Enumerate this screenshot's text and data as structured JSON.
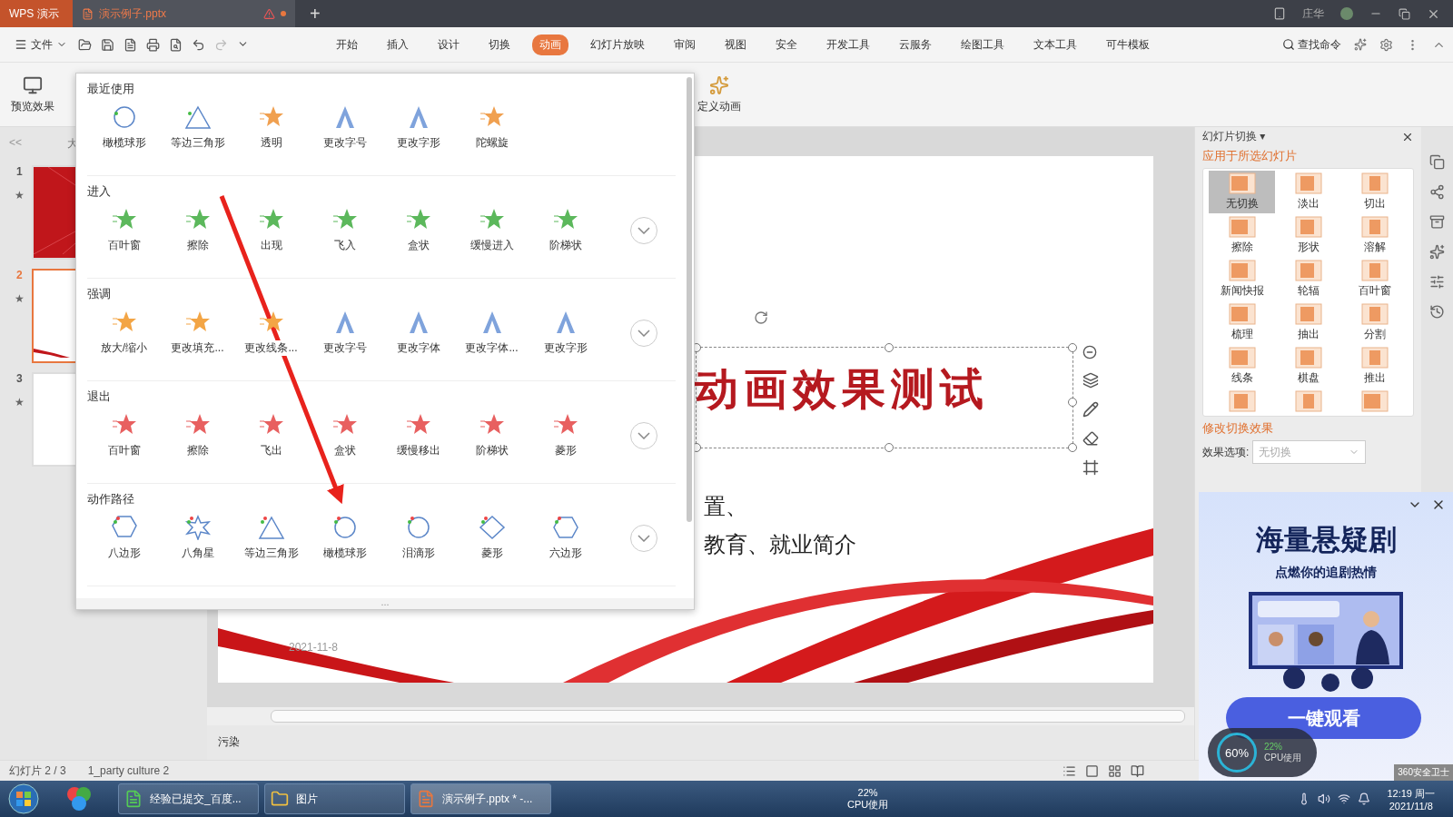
{
  "title_bar": {
    "tabs": [
      {
        "label": "WPS 演示",
        "kind": "app",
        "selected": false
      },
      {
        "label": "演示例子.pptx",
        "kind": "doc",
        "selected": true
      }
    ],
    "new_tab": "+",
    "user": "庄华"
  },
  "menu_bar": {
    "file": "文件",
    "tabs": [
      {
        "label": "开始",
        "selected": false
      },
      {
        "label": "插入",
        "selected": false
      },
      {
        "label": "设计",
        "selected": false
      },
      {
        "label": "切换",
        "selected": false
      },
      {
        "label": "动画",
        "selected": true
      },
      {
        "label": "幻灯片放映",
        "selected": false
      },
      {
        "label": "审阅",
        "selected": false
      },
      {
        "label": "视图",
        "selected": false
      },
      {
        "label": "安全",
        "selected": false
      },
      {
        "label": "开发工具",
        "selected": false
      },
      {
        "label": "云服务",
        "selected": false
      },
      {
        "label": "绘图工具",
        "selected": false
      },
      {
        "label": "文本工具",
        "selected": false
      },
      {
        "label": "可牛模板",
        "selected": false
      }
    ],
    "search": "查找命令"
  },
  "ribbon": {
    "preview": "预览效果",
    "custom_animation": "定义动画"
  },
  "animation_gallery": {
    "sections": [
      {
        "kind": "recent",
        "title": "最近使用",
        "expandable": false,
        "items": [
          "橄榄球形",
          "等边三角形",
          "透明",
          "更改字号",
          "更改字形",
          "陀螺旋"
        ]
      },
      {
        "kind": "enter",
        "title": "进入",
        "expandable": true,
        "items": [
          "百叶窗",
          "擦除",
          "出现",
          "飞入",
          "盒状",
          "缓慢进入",
          "阶梯状"
        ]
      },
      {
        "kind": "emphasis",
        "title": "强调",
        "expandable": true,
        "items": [
          "放大/缩小",
          "更改填充...",
          "更改线条...",
          "更改字号",
          "更改字体",
          "更改字体...",
          "更改字形"
        ]
      },
      {
        "kind": "exit",
        "title": "退出",
        "expandable": true,
        "items": [
          "百叶窗",
          "擦除",
          "飞出",
          "盒状",
          "缓慢移出",
          "阶梯状",
          "菱形"
        ]
      },
      {
        "kind": "path",
        "title": "动作路径",
        "expandable": true,
        "items": [
          "八边形",
          "八角星",
          "等边三角形",
          "橄榄球形",
          "泪滴形",
          "菱形",
          "六边形"
        ]
      }
    ],
    "handle": "..."
  },
  "slide_pane": {
    "collapse": "<<",
    "header": "大",
    "slides": [
      {
        "number": "1",
        "mark": "★",
        "kind": "title",
        "selected": false
      },
      {
        "number": "2",
        "mark": "★",
        "kind": "content",
        "selected": true
      },
      {
        "number": "3",
        "mark": "★",
        "kind": "blank",
        "selected": false
      }
    ]
  },
  "slide": {
    "title": "动画效果测试",
    "lines": [
      "置、",
      "教育、就业简介"
    ],
    "date": "2021-11-8"
  },
  "notes": "污染",
  "transition_pane": {
    "title": "幻灯片切换",
    "title_caret": "▾",
    "apply_label": "应用于所选幻灯片",
    "transitions": [
      {
        "label": "无切换",
        "selected": true
      },
      {
        "label": "淡出",
        "selected": false
      },
      {
        "label": "切出",
        "selected": false
      },
      {
        "label": "擦除",
        "selected": false
      },
      {
        "label": "形状",
        "selected": false
      },
      {
        "label": "溶解",
        "selected": false
      },
      {
        "label": "新闻快报",
        "selected": false
      },
      {
        "label": "轮辐",
        "selected": false
      },
      {
        "label": "百叶窗",
        "selected": false
      },
      {
        "label": "梳理",
        "selected": false
      },
      {
        "label": "抽出",
        "selected": false
      },
      {
        "label": "分割",
        "selected": false
      },
      {
        "label": "线条",
        "selected": false
      },
      {
        "label": "棋盘",
        "selected": false
      },
      {
        "label": "推出",
        "selected": false
      }
    ],
    "modify_label": "修改切换效果",
    "effect_label": "效果选项:",
    "effect_value": "无切换"
  },
  "ad": {
    "title": "海量悬疑剧",
    "subtitle": "点燃你的追剧热情",
    "button": "一键观看",
    "monitor": {
      "percent": "60%",
      "cpu": "22%",
      "cpu_label": "CPU使用"
    },
    "brand": "360安全卫士"
  },
  "status_bar": {
    "slide": "幻灯片 2 / 3",
    "theme": "1_party culture 2"
  },
  "taskbar": {
    "apps": [
      {
        "label": "经验已提交_百度...",
        "selected": false
      },
      {
        "label": "图片",
        "selected": false
      },
      {
        "label": "演示例子.pptx * -...",
        "selected": true
      }
    ],
    "cpu": "22%",
    "cpu_label": "CPU使用",
    "time": "12:19 周一",
    "date": "2021/11/8"
  }
}
